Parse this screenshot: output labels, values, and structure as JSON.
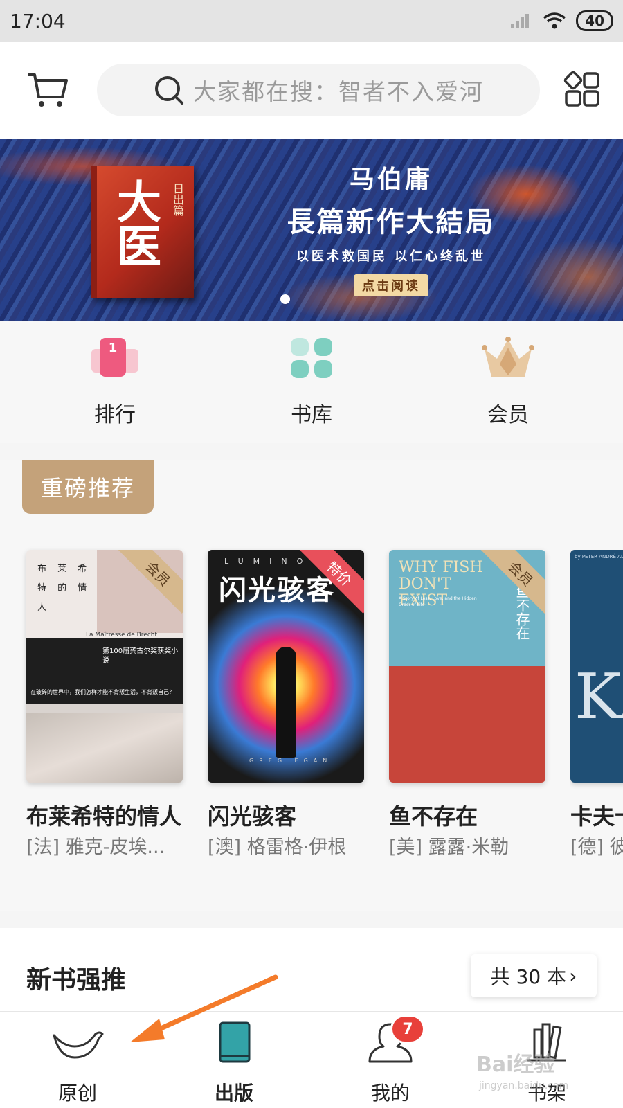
{
  "status_bar": {
    "time": "17:04",
    "battery": "40"
  },
  "header": {
    "search_placeholder": "大家都在搜：智者不入爱河"
  },
  "banner": {
    "book_title": "大医",
    "book_subtitle": "日出篇",
    "line1": "马伯庸",
    "line2": "長篇新作大結局",
    "line3": "以医术救国民 以仁心终乱世",
    "button": "点击阅读"
  },
  "quick_entries": [
    {
      "label": "排行",
      "icon": "rank-icon",
      "badge_number": "1"
    },
    {
      "label": "书库",
      "icon": "library-icon"
    },
    {
      "label": "会员",
      "icon": "crown-icon"
    }
  ],
  "recommended": {
    "section_tag": "重磅推荐",
    "books": [
      {
        "title": "布莱希特的情人",
        "author": "[法] 雅克-皮埃...",
        "ribbon": "会员",
        "cover_title": "布 莱 希 特 的 情 人",
        "cover_subtitle": "La Maîtresse de Brecht",
        "cover_award": "第100届龚古尔奖获奖小说",
        "cover_tagline": "在破碎的世界中，我们怎样才能不背叛生活，不背叛自己？"
      },
      {
        "title": "闪光骇客",
        "author": "[澳] 格雷格·伊根",
        "ribbon": "特价",
        "cover_title": "闪光骇客",
        "cover_series": "LUMINOUS",
        "cover_author_en": "GREG EGAN"
      },
      {
        "title": "鱼不存在",
        "author": "[美] 露露·米勒",
        "ribbon": "会员",
        "cover_title_en": "WHY FISH DON'T EXIST",
        "cover_title_cn": "鱼不存在",
        "cover_subtitle": "A Story of Loss, Love, and the Hidden Order of Life"
      },
      {
        "title": "卡夫卡",
        "author": "[德] 彼得-安德烈·阿尔特",
        "cover_top": "by PETER ANDRÉ ALT",
        "cover_letters": "KA"
      }
    ]
  },
  "new_books": {
    "title": "新书强推",
    "count": "共 30 本"
  },
  "bottom_nav": [
    {
      "label": "原创",
      "icon": "bird-icon"
    },
    {
      "label": "出版",
      "icon": "book-icon",
      "active": true
    },
    {
      "label": "我的",
      "icon": "user-icon",
      "badge": "7"
    },
    {
      "label": "书架",
      "icon": "bookshelf-icon"
    }
  ],
  "watermark": {
    "text": "Bai经验",
    "sub": "jingyan.baidu.com"
  },
  "colors": {
    "tag": "#c4a27a",
    "ribbon_member": "#d6b88d",
    "ribbon_sale": "#e8505b",
    "badge": "#e8403a",
    "library_icon": "#7ecfc0"
  }
}
